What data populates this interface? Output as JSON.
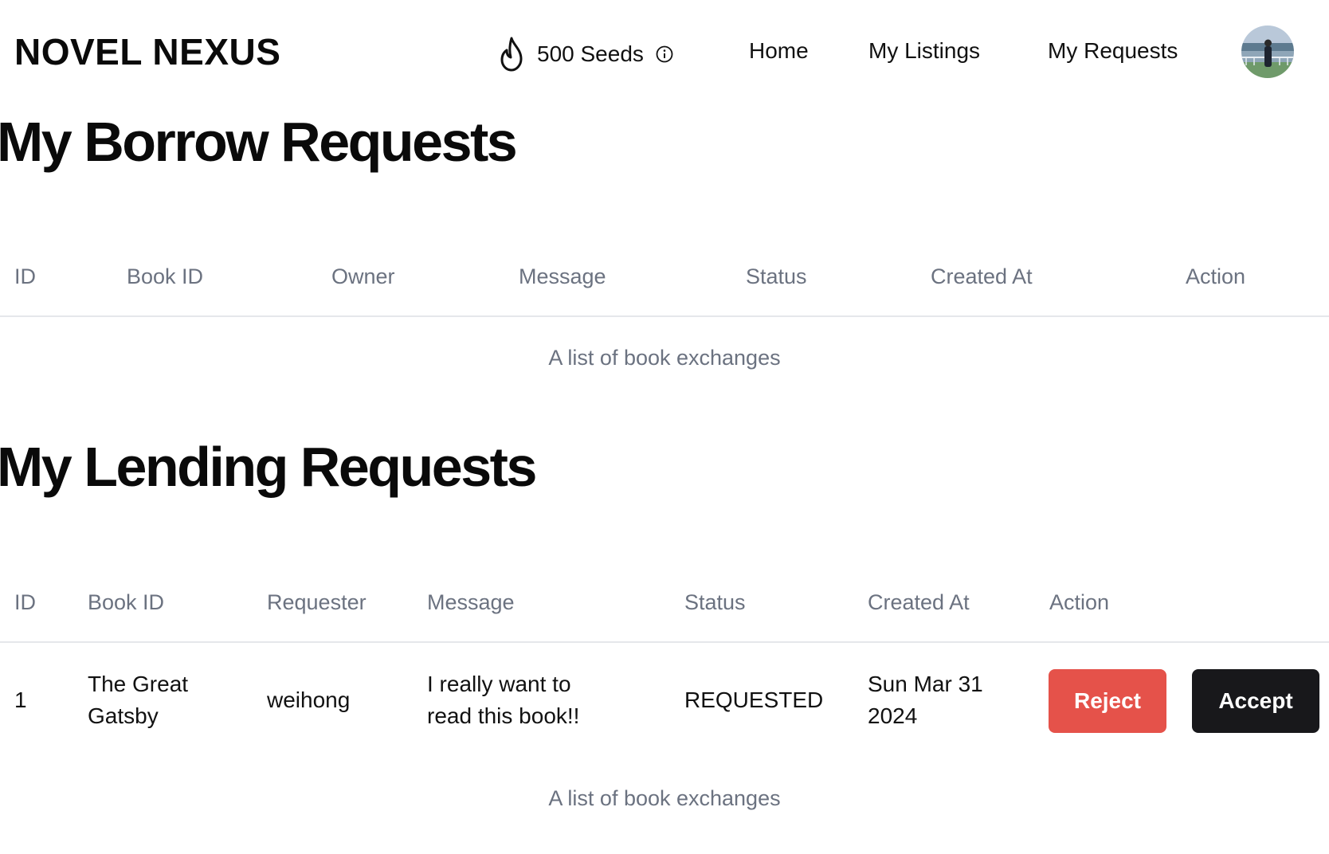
{
  "nav": {
    "brand": "NOVEL NEXUS",
    "seeds": "500 Seeds",
    "links": [
      "Home",
      "My Listings",
      "My Requests"
    ]
  },
  "borrow": {
    "title": "My Borrow Requests",
    "columns": [
      "ID",
      "Book ID",
      "Owner",
      "Message",
      "Status",
      "Created At",
      "Action"
    ],
    "caption": "A list of book exchanges"
  },
  "lending": {
    "title": "My Lending Requests",
    "columns": [
      "ID",
      "Book ID",
      "Requester",
      "Message",
      "Status",
      "Created At",
      "Action"
    ],
    "rows": [
      {
        "id": "1",
        "book_line1": "The Great",
        "book_line2": "Gatsby",
        "requester": "weihong",
        "message_line1": "I really want to",
        "message_line2": "read this book!!",
        "status": "REQUESTED",
        "created_line1": "Sun Mar 31",
        "created_line2": "2024",
        "reject_label": "Reject",
        "accept_label": "Accept"
      }
    ],
    "caption": "A list of book exchanges"
  },
  "colors": {
    "reject": "#e5524a",
    "accept": "#18181b",
    "muted_text": "#6b7280"
  },
  "icons": [
    "flame-icon",
    "info-icon",
    "avatar"
  ]
}
